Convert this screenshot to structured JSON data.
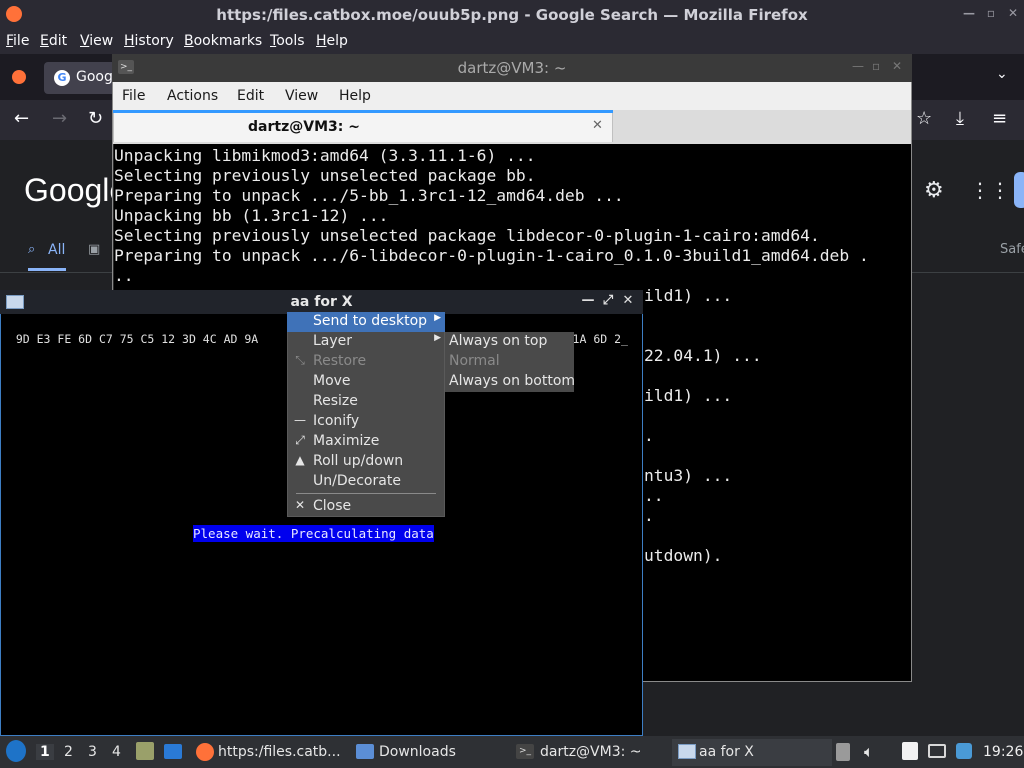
{
  "firefox": {
    "window_title": "https:/files.catbox.moe/ouub5p.png - Google Search — Mozilla Firefox",
    "menu": [
      "File",
      "Edit",
      "View",
      "History",
      "Bookmarks",
      "Tools",
      "Help"
    ],
    "tab_label": "Goog",
    "google_logo": "Google",
    "search_tab_all": "All",
    "safe_label": "Safe"
  },
  "terminal": {
    "window_title": "dartz@VM3: ~",
    "menu": [
      "File",
      "Actions",
      "Edit",
      "View",
      "Help"
    ],
    "tab_title": "dartz@VM3: ~",
    "lines": [
      "Unpacking libmikmod3:amd64 (3.3.11.1-6) ...",
      "Selecting previously unselected package bb.",
      "Preparing to unpack .../5-bb_1.3rc1-12_amd64.deb ...",
      "Unpacking bb (1.3rc1-12) ...",
      "Selecting previously unselected package libdecor-0-plugin-1-cairo:amd64.",
      "Preparing to unpack .../6-libdecor-0-plugin-1-cairo_0.1.0-3build1_amd64.deb .",
      ".."
    ],
    "partial_lines": [
      "ild1) ...",
      "22.04.1) ...",
      "ild1) ...",
      ".",
      "ntu3) ...",
      "..",
      ".",
      "utdown)."
    ]
  },
  "aa_window": {
    "title": "aa for X",
    "hex_left": "9D E3 FE 6D C7 75 C5 12 3D 4C AD 9A",
    "hex_right": "4 70 C3 2B 4E 40 1A 6D 2_",
    "wait_message": "Please wait. Precalculating data"
  },
  "context_menu": {
    "items": [
      {
        "label": "Send to desktop",
        "icon": "",
        "submenu": true,
        "state": "active"
      },
      {
        "label": "Layer",
        "icon": "",
        "submenu": true,
        "state": "normal"
      },
      {
        "label": "Restore",
        "icon": "restore-icon",
        "submenu": false,
        "state": "disabled"
      },
      {
        "label": "Move",
        "icon": "",
        "submenu": false,
        "state": "normal"
      },
      {
        "label": "Resize",
        "icon": "",
        "submenu": false,
        "state": "normal"
      },
      {
        "label": "Iconify",
        "icon": "iconify-icon",
        "submenu": false,
        "state": "normal"
      },
      {
        "label": "Maximize",
        "icon": "maximize-icon",
        "submenu": false,
        "state": "normal"
      },
      {
        "label": "Roll up/down",
        "icon": "rollup-icon",
        "submenu": false,
        "state": "normal"
      },
      {
        "label": "Un/Decorate",
        "icon": "",
        "submenu": false,
        "state": "normal"
      },
      {
        "label": "Close",
        "icon": "close-icon",
        "submenu": false,
        "state": "normal"
      }
    ],
    "layer_submenu": [
      {
        "label": "Always on top",
        "state": "normal"
      },
      {
        "label": "Normal",
        "state": "disabled"
      },
      {
        "label": "Always on bottom",
        "state": "normal"
      }
    ]
  },
  "taskbar": {
    "workspaces": [
      "1",
      "2",
      "3",
      "4"
    ],
    "active_workspace": "1",
    "tasks": [
      {
        "label": "https:/files.catb...",
        "icon": "firefox-icon"
      },
      {
        "label": "Downloads",
        "icon": "folder-icon"
      },
      {
        "label": "dartz@VM3: ~",
        "icon": "terminal-icon"
      },
      {
        "label": "aa for X",
        "icon": "window-icon"
      }
    ],
    "clock": "19:26"
  }
}
